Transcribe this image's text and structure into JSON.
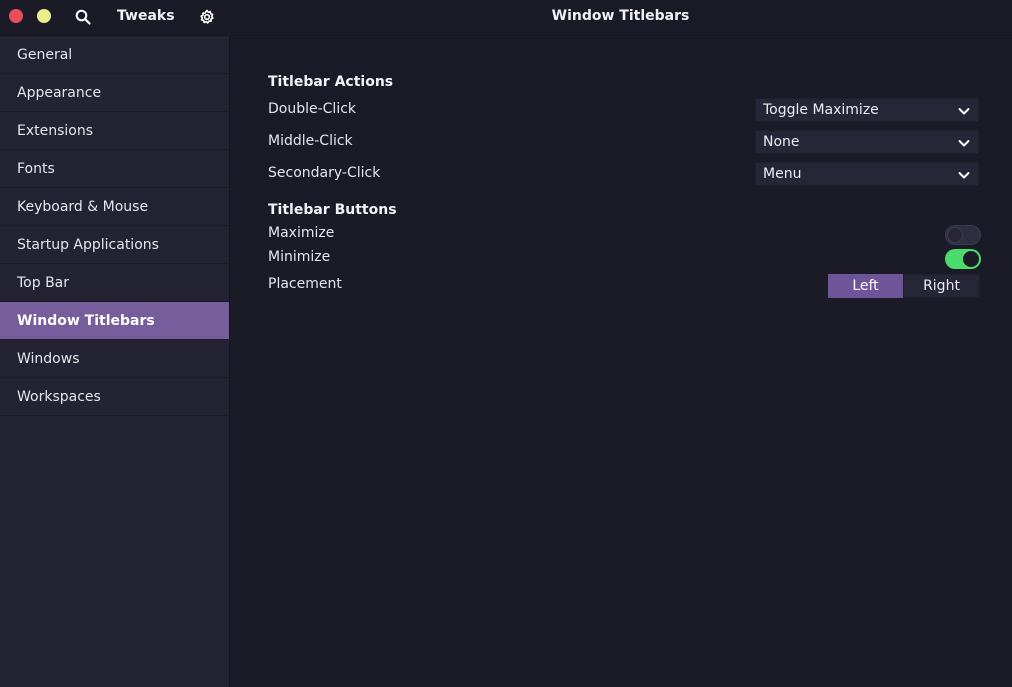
{
  "header": {
    "app_title": "Tweaks",
    "page_title": "Window Titlebars",
    "colors": {
      "close": "#ee4b5a",
      "minimize": "#e8ef8a"
    },
    "icons": [
      "search-icon",
      "gear-icon"
    ]
  },
  "sidebar": {
    "items": [
      {
        "label": "General"
      },
      {
        "label": "Appearance"
      },
      {
        "label": "Extensions"
      },
      {
        "label": "Fonts"
      },
      {
        "label": "Keyboard & Mouse"
      },
      {
        "label": "Startup Applications"
      },
      {
        "label": "Top Bar"
      },
      {
        "label": "Window Titlebars",
        "active": true
      },
      {
        "label": "Windows"
      },
      {
        "label": "Workspaces"
      }
    ],
    "active_color": "#765e9c"
  },
  "actions": {
    "title": "Titlebar Actions",
    "double_click": {
      "label": "Double-Click",
      "value": "Toggle Maximize"
    },
    "middle_click": {
      "label": "Middle-Click",
      "value": "None"
    },
    "secondary_click": {
      "label": "Secondary-Click",
      "value": "Menu"
    }
  },
  "buttons": {
    "title": "Titlebar Buttons",
    "maximize": {
      "label": "Maximize",
      "enabled": false
    },
    "minimize": {
      "label": "Minimize",
      "enabled": true
    },
    "placement": {
      "label": "Placement",
      "options": [
        "Left",
        "Right"
      ],
      "selected": "Left"
    },
    "switch_on_color": "#4bdb6d"
  }
}
